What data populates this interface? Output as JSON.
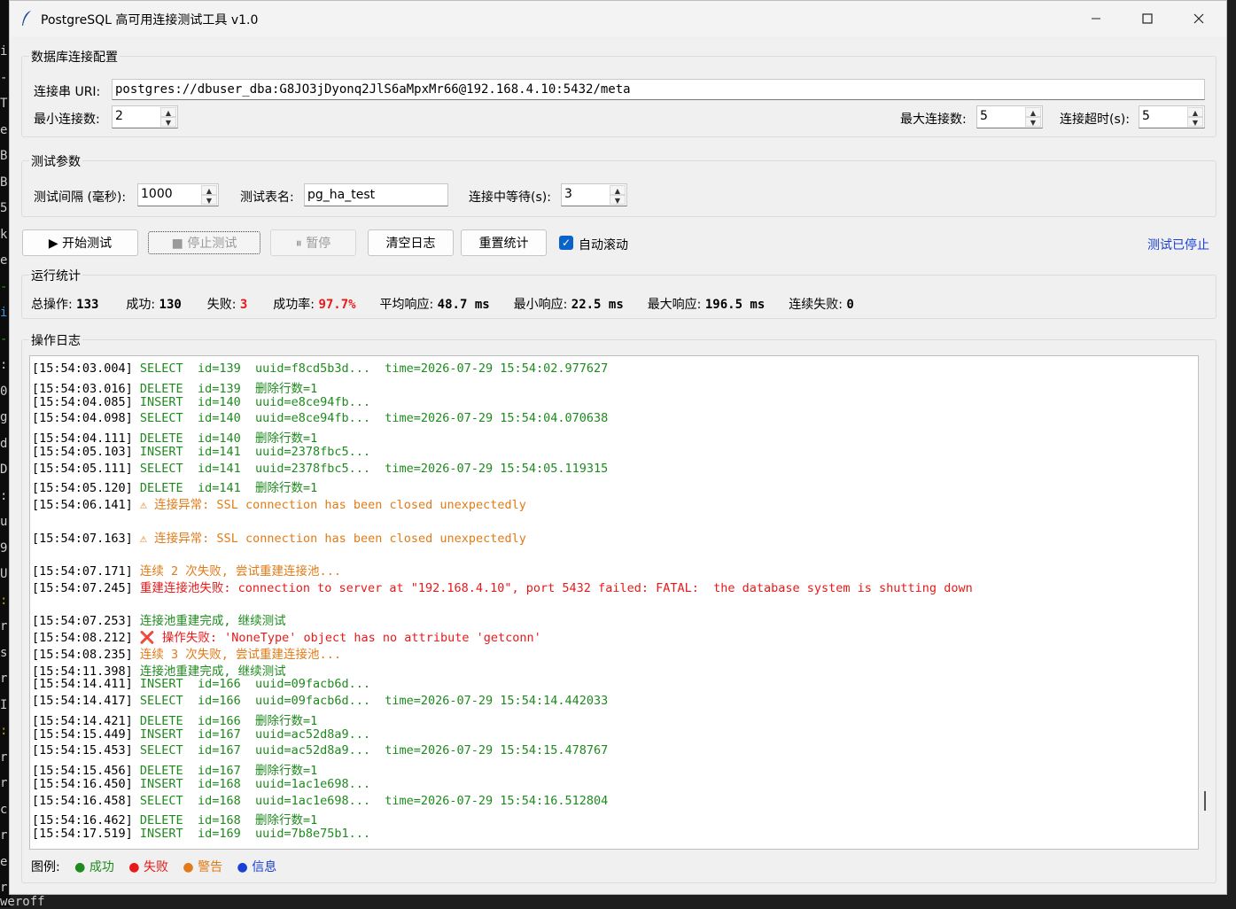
{
  "app": {
    "title": "PostgreSQL 高可用连接测试工具 v1.0",
    "min_symbol": "—",
    "max_symbol": "☐",
    "close_symbol": "✕"
  },
  "connection": {
    "group_label": "数据库连接配置",
    "uri_label": "连接串 URI:",
    "uri_value": "postgres://dbuser_dba:G8JO3jDyonq2JlS6aMpxMr66@192.168.4.10:5432/meta",
    "min_conn_label": "最小连接数:",
    "min_conn_value": "2",
    "max_conn_label": "最大连接数:",
    "max_conn_value": "5",
    "timeout_label": "连接超时(s):",
    "timeout_value": "5"
  },
  "params": {
    "group_label": "测试参数",
    "interval_label": "测试间隔 (毫秒):",
    "interval_value": "1000",
    "table_label": "测试表名:",
    "table_value": "pg_ha_test",
    "wait_label": "连接中等待(s):",
    "wait_value": "3"
  },
  "toolbar": {
    "start": "▶ 开始测试",
    "stop": "■ 停止测试",
    "pause": "⏸ 暂停",
    "clear": "清空日志",
    "reset": "重置统计",
    "autoscroll": "自动滚动",
    "autoscroll_checked": true,
    "status": "测试已停止",
    "status_color": "#1a3fd6"
  },
  "stats": {
    "group_label": "运行统计",
    "total_label": "总操作:",
    "total_value": "133",
    "success_label": "成功:",
    "success_value": "130",
    "fail_label": "失败:",
    "fail_value": "3",
    "rate_label": "成功率:",
    "rate_value": "97.7%",
    "avg_label": "平均响应:",
    "avg_value": "48.7 ms",
    "min_label": "最小响应:",
    "min_value": "22.5 ms",
    "max_label": "最大响应:",
    "max_value": "196.5 ms",
    "consec_label": "连续失败:",
    "consec_value": "0"
  },
  "log": {
    "group_label": "操作日志",
    "colors": {
      "success": "#1e8a1e",
      "error": "#e81919",
      "warning": "#e07b17",
      "info": "#1a3fd6"
    },
    "lines": [
      {
        "ts": "[15:54:03.004]",
        "msg": "SELECT  id=139  uuid=f8cd5b3d...  time=2026-07-29 15:54:02.977627",
        "kind": "success"
      },
      {
        "ts": "[15:54:03.016]",
        "msg": "DELETE  id=139  删除行数=1",
        "kind": "success"
      },
      {
        "ts": "[15:54:04.085]",
        "msg": "INSERT  id=140  uuid=e8ce94fb...",
        "kind": "success"
      },
      {
        "ts": "[15:54:04.098]",
        "msg": "SELECT  id=140  uuid=e8ce94fb...  time=2026-07-29 15:54:04.070638",
        "kind": "success"
      },
      {
        "ts": "[15:54:04.111]",
        "msg": "DELETE  id=140  删除行数=1",
        "kind": "success"
      },
      {
        "ts": "[15:54:05.103]",
        "msg": "INSERT  id=141  uuid=2378fbc5...",
        "kind": "success"
      },
      {
        "ts": "[15:54:05.111]",
        "msg": "SELECT  id=141  uuid=2378fbc5...  time=2026-07-29 15:54:05.119315",
        "kind": "success"
      },
      {
        "ts": "[15:54:05.120]",
        "msg": "DELETE  id=141  删除行数=1",
        "kind": "success"
      },
      {
        "ts": "[15:54:06.141]",
        "msg": "⚠ 连接异常: SSL connection has been closed unexpectedly",
        "kind": "warning"
      },
      {
        "ts": "",
        "msg": "",
        "kind": "blank"
      },
      {
        "ts": "[15:54:07.163]",
        "msg": "⚠ 连接异常: SSL connection has been closed unexpectedly",
        "kind": "warning"
      },
      {
        "ts": "",
        "msg": "",
        "kind": "blank"
      },
      {
        "ts": "[15:54:07.171]",
        "msg": "连续 2 次失败, 尝试重建连接池...",
        "kind": "warning"
      },
      {
        "ts": "[15:54:07.245]",
        "msg": "重建连接池失败: connection to server at \"192.168.4.10\", port 5432 failed: FATAL:  the database system is shutting down",
        "kind": "error"
      },
      {
        "ts": "",
        "msg": "",
        "kind": "blank"
      },
      {
        "ts": "[15:54:07.253]",
        "msg": "连接池重建完成, 继续测试",
        "kind": "success"
      },
      {
        "ts": "[15:54:08.212]",
        "msg": "❌ 操作失败: 'NoneType' object has no attribute 'getconn'",
        "kind": "error"
      },
      {
        "ts": "[15:54:08.235]",
        "msg": "连续 3 次失败, 尝试重建连接池...",
        "kind": "warning"
      },
      {
        "ts": "[15:54:11.398]",
        "msg": "连接池重建完成, 继续测试",
        "kind": "success"
      },
      {
        "ts": "[15:54:14.411]",
        "msg": "INSERT  id=166  uuid=09facb6d...",
        "kind": "success"
      },
      {
        "ts": "[15:54:14.417]",
        "msg": "SELECT  id=166  uuid=09facb6d...  time=2026-07-29 15:54:14.442033",
        "kind": "success"
      },
      {
        "ts": "[15:54:14.421]",
        "msg": "DELETE  id=166  删除行数=1",
        "kind": "success"
      },
      {
        "ts": "[15:54:15.449]",
        "msg": "INSERT  id=167  uuid=ac52d8a9...",
        "kind": "success"
      },
      {
        "ts": "[15:54:15.453]",
        "msg": "SELECT  id=167  uuid=ac52d8a9...  time=2026-07-29 15:54:15.478767",
        "kind": "success"
      },
      {
        "ts": "[15:54:15.456]",
        "msg": "DELETE  id=167  删除行数=1",
        "kind": "success"
      },
      {
        "ts": "[15:54:16.450]",
        "msg": "INSERT  id=168  uuid=1ac1e698...",
        "kind": "success"
      },
      {
        "ts": "[15:54:16.458]",
        "msg": "SELECT  id=168  uuid=1ac1e698...  time=2026-07-29 15:54:16.512804",
        "kind": "success"
      },
      {
        "ts": "[15:54:16.462]",
        "msg": "DELETE  id=168  删除行数=1",
        "kind": "success"
      },
      {
        "ts": "[15:54:17.519]",
        "msg": "INSERT  id=169  uuid=7b8e75b1...",
        "kind": "success"
      }
    ]
  },
  "legend": {
    "label": "图例:",
    "success": "● 成功",
    "error": "● 失败",
    "warning": "● 警告",
    "info": "● 信息"
  },
  "background": {
    "terminal_chars": [
      "i",
      "-",
      "T",
      "e",
      "B",
      "B",
      "5",
      "k",
      "e",
      "-",
      "i",
      "-",
      ":",
      "0",
      "g",
      "d",
      "D",
      ":",
      "u",
      "9",
      "U",
      ":",
      "r",
      "s",
      "r",
      "I",
      ":",
      "r",
      "r",
      "c",
      "r",
      "e",
      "r"
    ],
    "bottom_text": "weroff"
  }
}
